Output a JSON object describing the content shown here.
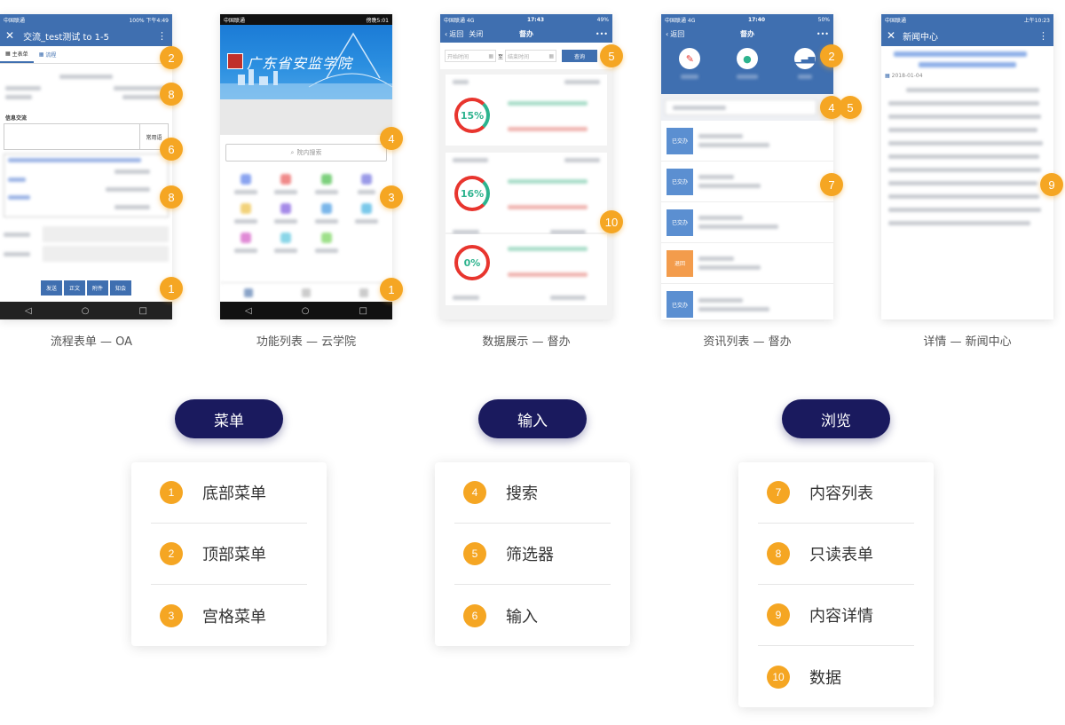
{
  "phones": {
    "oa": {
      "status_left": "中国联通",
      "status_right": "100% 下午4:49",
      "title": "交流_test测试 to 1-5",
      "tab_main": "主表单",
      "tab_other": "流程",
      "section_label": "信息交流",
      "common_btn": "常用语",
      "bottom_buttons": [
        "发送",
        "正文",
        "附件",
        "知会"
      ],
      "caption": "流程表单 — OA"
    },
    "college": {
      "status_left": "中国联通",
      "status_right": "傍晚5:01",
      "banner_title": "广东省安监学院",
      "search_placeholder": "院内搜索",
      "caption": "功能列表 — 云学院"
    },
    "data": {
      "status_left": "中国联通 4G",
      "status_time": "17:43",
      "status_right": "49%",
      "back": "返回",
      "close": "关闭",
      "title": "督办",
      "more": "•••",
      "start_placeholder": "开始时间",
      "to_label": "至",
      "end_placeholder": "结束时间",
      "query_btn": "查询",
      "percents": [
        "15%",
        "16%",
        "0%"
      ],
      "caption": "数据展示 — 督办"
    },
    "news_list": {
      "status_left": "中国联通 4G",
      "status_time": "17:40",
      "status_right": "50%",
      "back": "返回",
      "title": "督办",
      "more": "•••",
      "tags": [
        "已交办",
        "已交办",
        "已交办",
        "退回",
        "已交办"
      ],
      "caption": "资讯列表 — 督办"
    },
    "detail": {
      "status_left": "中国联通",
      "status_right": "上午10:23",
      "title": "新闻中心",
      "date": "2018-01-04",
      "caption": "详情 — 新闻中心"
    }
  },
  "badges": {
    "oa": [
      "2",
      "8",
      "6",
      "8",
      "1"
    ],
    "college": [
      "4",
      "3",
      "1"
    ],
    "data": [
      "5",
      "10"
    ],
    "news_list": [
      "2",
      "4",
      "5",
      "7"
    ],
    "detail": [
      "9"
    ]
  },
  "groups": [
    {
      "name": "菜单",
      "items": [
        {
          "num": "1",
          "label": "底部菜单"
        },
        {
          "num": "2",
          "label": "顶部菜单"
        },
        {
          "num": "3",
          "label": "宫格菜单"
        }
      ]
    },
    {
      "name": "输入",
      "items": [
        {
          "num": "4",
          "label": "搜索"
        },
        {
          "num": "5",
          "label": "筛选器"
        },
        {
          "num": "6",
          "label": "输入"
        }
      ]
    },
    {
      "name": "浏览",
      "items": [
        {
          "num": "7",
          "label": "内容列表"
        },
        {
          "num": "8",
          "label": "只读表单"
        },
        {
          "num": "9",
          "label": "内容详情"
        },
        {
          "num": "10",
          "label": "数据"
        }
      ]
    }
  ],
  "colors": {
    "header_blue": "#3f6fb0",
    "badge_orange": "#f5a623",
    "pill_navy": "#1a1a5e",
    "ring_red": "#e8352e",
    "ring_green": "#2db38e",
    "tag_blue": "#5b8fd1",
    "tag_orange": "#f39c4c"
  }
}
